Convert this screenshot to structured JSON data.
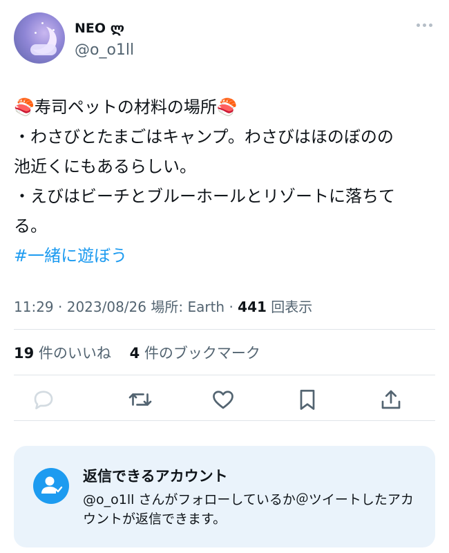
{
  "user": {
    "name": "NEO ლ",
    "handle": "@o_o1ll"
  },
  "tweet": {
    "line1": "🍣寿司ペットの材料の場所🍣",
    "line2": "・わさびとたまごはキャンプ。わさびはほのぼのの",
    "line3": "池近くにもあるらしい。",
    "line4": "・えびはビーチとブルーホールとリゾートに落ちて",
    "line5": "る。",
    "hashtag": "#一緒に遊ぼう"
  },
  "meta": {
    "time": "11:29",
    "date": "2023/08/26",
    "location": "場所: Earth",
    "views_count": "441",
    "views_label": "回表示"
  },
  "stats": {
    "likes_count": "19",
    "likes_label": "件のいいね",
    "bookmarks_count": "4",
    "bookmarks_label": "件のブックマーク"
  },
  "actions": [
    "reply-icon",
    "retweet-icon",
    "like-icon",
    "bookmark-icon",
    "share-icon"
  ],
  "reply_card": {
    "title": "返信できるアカウント",
    "body": "@o_o1ll さんがフォローしているか＠ツイートしたアカウントが返信できます。"
  },
  "colors": {
    "accent": "#1d9bf0",
    "secondary_text": "#536471",
    "card_bg": "#eaf3fb"
  }
}
